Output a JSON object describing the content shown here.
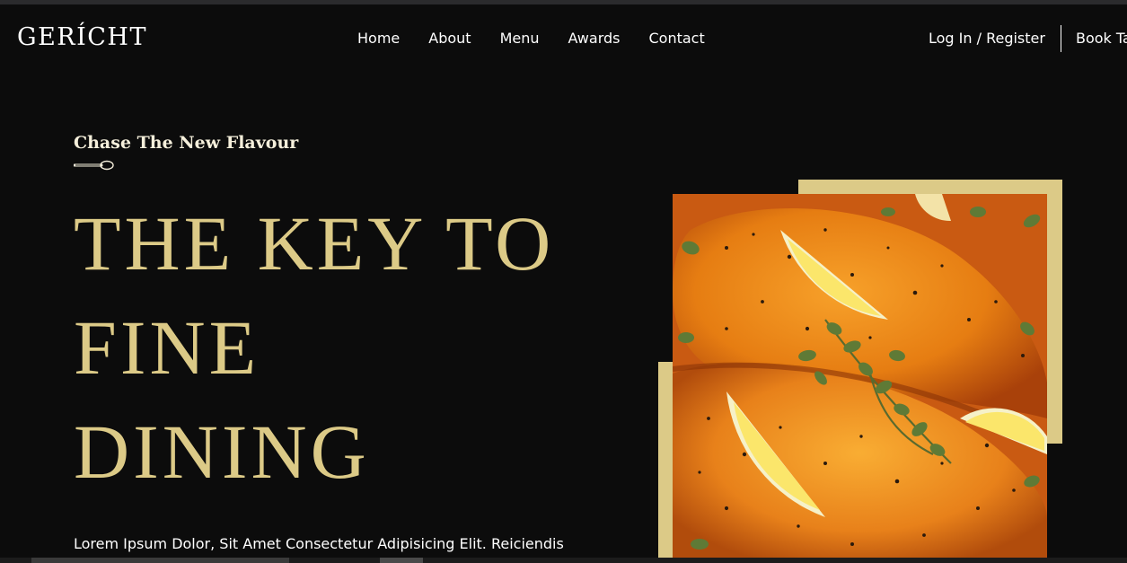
{
  "header": {
    "logo": "GERÍCHT",
    "nav_items": [
      "Home",
      "About",
      "Menu",
      "Awards",
      "Contact"
    ],
    "login_label": "Log In / Register",
    "book_label": "Book Ta"
  },
  "hero": {
    "subtitle": "Chase The New Flavour",
    "title_lines": [
      "THE KEY TO",
      "FINE",
      "DINING"
    ],
    "description": "Lorem Ipsum Dolor, Sit Amet Consectetur Adipisicing Elit. Reiciendis"
  },
  "colors": {
    "background": "#0c0c0c",
    "gold": "#dcca87",
    "white": "#ffffff"
  },
  "icons": {
    "spoon": "spoon-icon"
  }
}
